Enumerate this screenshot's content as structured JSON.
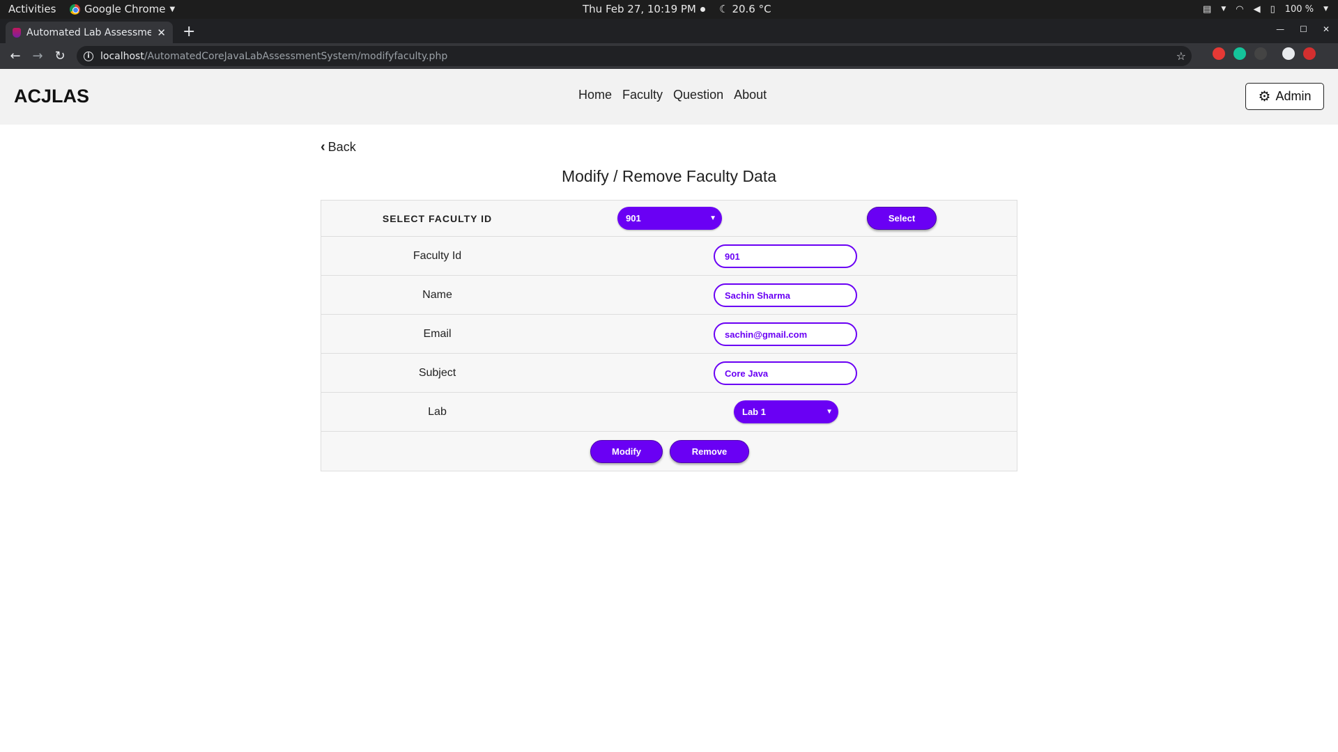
{
  "os_bar": {
    "activities": "Activities",
    "app_name": "Google Chrome",
    "clock": "Thu Feb 27, 10:19 PM",
    "weather": "20.6 °C",
    "battery": "100 %"
  },
  "browser": {
    "tab_title": "Automated Lab Assessme",
    "url_host": "localhost",
    "url_path": "/AutomatedCoreJavaLabAssessmentSystem/modifyfaculty.php"
  },
  "site": {
    "brand": "ACJLAS",
    "menu": [
      "Home",
      "Faculty",
      "Question",
      "About"
    ],
    "admin_label": "Admin"
  },
  "content": {
    "back_label": "Back",
    "title": "Modify / Remove Faculty Data",
    "select_label": "SELECT FACULTY ID",
    "selected_faculty_id": "901",
    "select_button": "Select",
    "fields": {
      "faculty_id": {
        "label": "Faculty Id",
        "value": "901"
      },
      "name": {
        "label": "Name",
        "value": "Sachin Sharma"
      },
      "email": {
        "label": "Email",
        "value": "sachin@gmail.com"
      },
      "subject": {
        "label": "Subject",
        "value": "Core Java"
      },
      "lab": {
        "label": "Lab",
        "value": "Lab 1"
      }
    },
    "modify_button": "Modify",
    "remove_button": "Remove"
  },
  "colors": {
    "accent": "#6a00f4",
    "navbar_bg": "#f2f2f2"
  }
}
